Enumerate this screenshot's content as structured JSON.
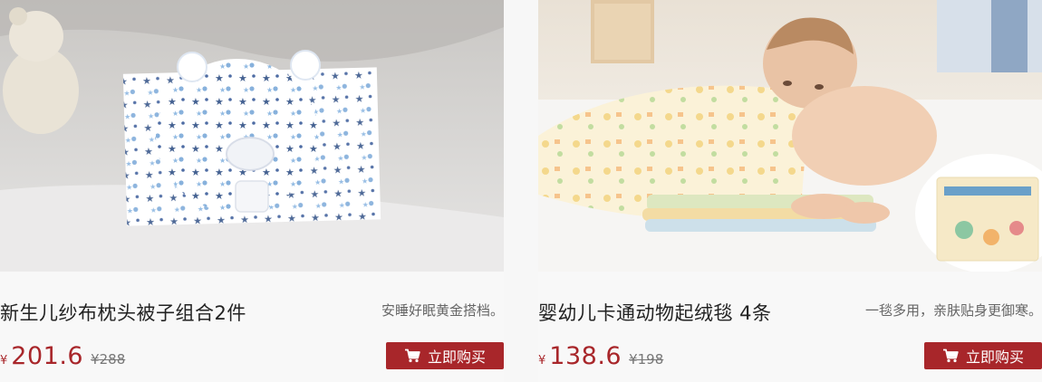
{
  "products": [
    {
      "title": "新生儿纱布枕头被子组合2件",
      "slogan": "安睡好眠黄金搭档。",
      "currency": "¥",
      "price": "201.6",
      "original_price": "¥288",
      "buy_label": "立即购买",
      "image": "pillow-blanket-photo"
    },
    {
      "title": "婴幼儿卡通动物起绒毯 4条",
      "slogan": "一毯多用，亲肤贴身更御寒。",
      "currency": "¥",
      "price": "138.6",
      "original_price": "¥198",
      "buy_label": "立即购买",
      "image": "baby-on-blanket-photo"
    }
  ],
  "colors": {
    "accent": "#a8262a",
    "background": "#f7f7f7",
    "title_text": "#222222",
    "slogan_text": "#666666"
  },
  "icons": {
    "buy": "shopping-cart-icon"
  }
}
